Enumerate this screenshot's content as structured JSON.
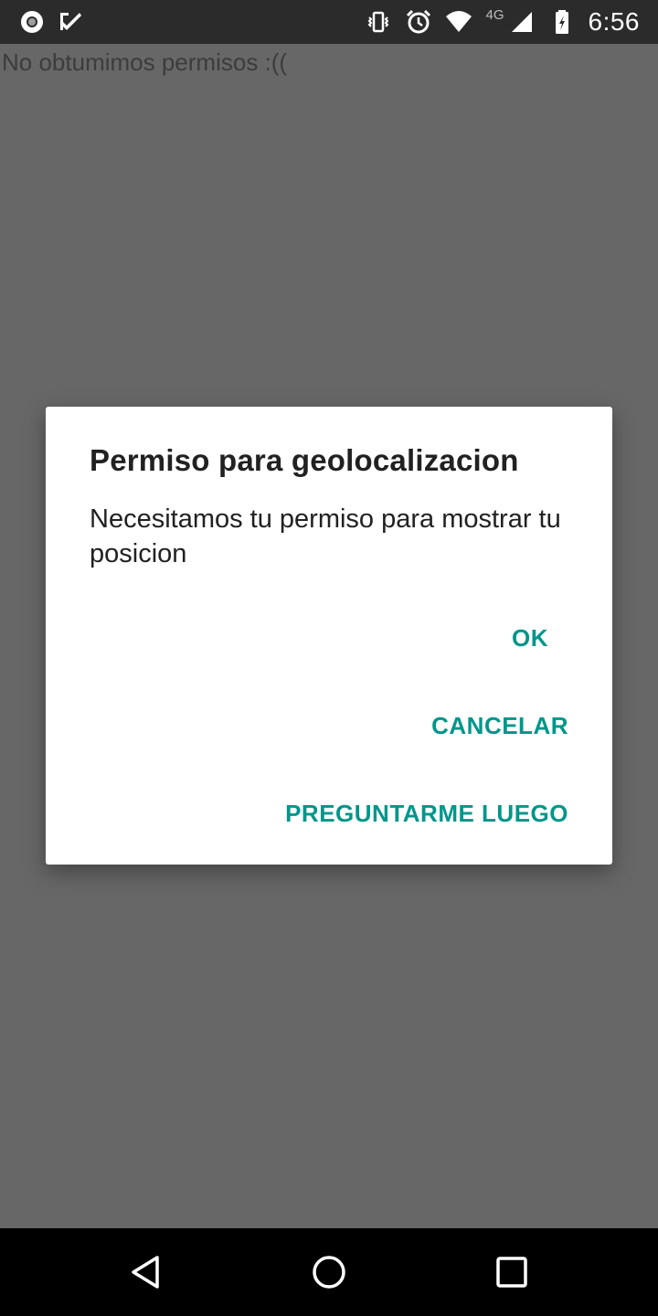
{
  "status_bar": {
    "left_icons": [
      "record-icon",
      "checkmark-app-icon"
    ],
    "right_icons": [
      "vibrate-icon",
      "alarm-icon",
      "wifi-icon",
      "signal-icon",
      "battery-icon"
    ],
    "network_type": "4G",
    "time": "6:56"
  },
  "background": {
    "message": "No obtumimos permisos :(("
  },
  "dialog": {
    "title": "Permiso para geolocalizacion",
    "message": "Necesitamos tu permiso para mostrar tu posicion",
    "buttons": {
      "ok": "OK",
      "cancel": "CANCELAR",
      "later": "PREGUNTARME LUEGO"
    },
    "accent_color": "#00968a"
  },
  "nav_bar": {
    "icons": [
      "back-icon",
      "home-icon",
      "recents-icon"
    ]
  }
}
